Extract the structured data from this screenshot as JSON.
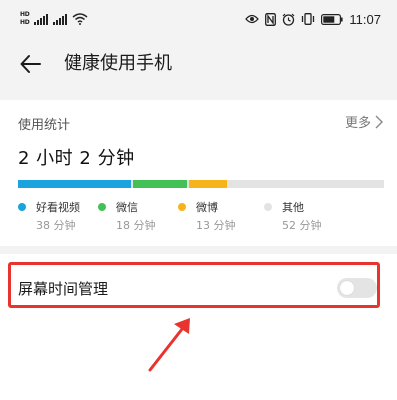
{
  "status_bar": {
    "hd_top": "HD",
    "hd_bottom": "HD",
    "sim1": "4G",
    "sim2": "4G",
    "time": "11:07",
    "icons": [
      "eye-icon",
      "nfc-icon",
      "alarm-icon",
      "vibrate-icon",
      "battery-icon"
    ]
  },
  "header": {
    "title": "健康使用手机",
    "back_icon": "arrow-left-icon"
  },
  "usage": {
    "label": "使用统计",
    "more": "更多",
    "total": "2 小时 2 分钟",
    "apps": [
      {
        "name": "好看视频",
        "duration": "38 分钟",
        "minutes": 38,
        "color": "#1aa3de"
      },
      {
        "name": "微信",
        "duration": "18 分钟",
        "minutes": 18,
        "color": "#43c157"
      },
      {
        "name": "微博",
        "duration": "13 分钟",
        "minutes": 13,
        "color": "#f5b41a"
      },
      {
        "name": "其他",
        "duration": "52 分钟",
        "minutes": 52,
        "color": "#e3e3e3"
      }
    ]
  },
  "screen_time": {
    "label": "屏幕时间管理",
    "enabled": false
  },
  "annotation": {
    "highlight_color": "#e8332e"
  }
}
